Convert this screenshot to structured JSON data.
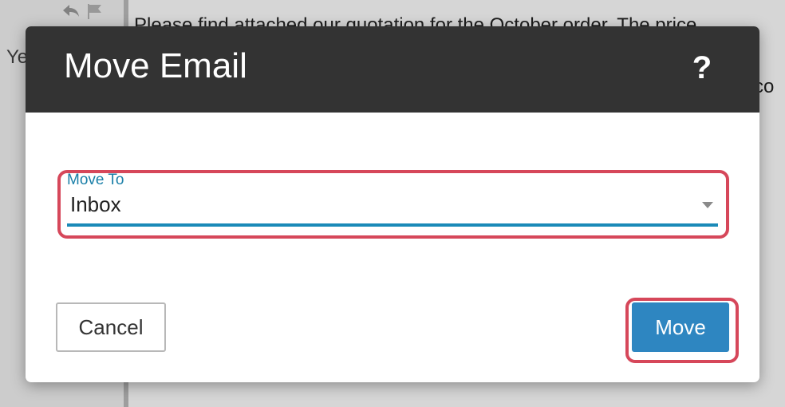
{
  "background": {
    "sender_snippet": "Ye",
    "body_line_1": "Please find attached our quotation for the October order. The price",
    "body_line_2": "e co"
  },
  "modal": {
    "title": "Move Email",
    "help_label": "?",
    "field": {
      "label": "Move To",
      "value": "Inbox"
    },
    "cancel_label": "Cancel",
    "move_label": "Move"
  },
  "colors": {
    "header_bg": "#333333",
    "accent": "#1a8ab8",
    "primary_button": "#2e86c1",
    "highlight": "#d6475a"
  }
}
